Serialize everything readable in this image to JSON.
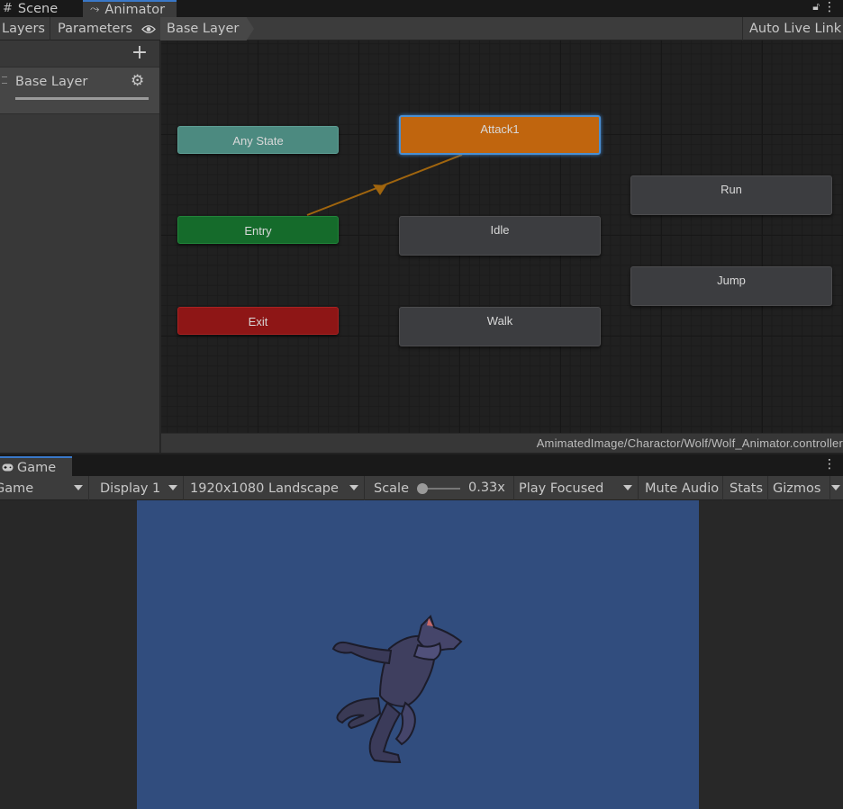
{
  "editor_tabs": {
    "scene": "Scene",
    "animator": "Animator"
  },
  "animator_toolbar": {
    "layers": "Layers",
    "parameters": "Parameters",
    "breadcrumb": "Base Layer",
    "auto_live_link": "Auto Live Link"
  },
  "layers_panel": {
    "add": "+",
    "layer_name": "Base Layer"
  },
  "graph": {
    "nodes": {
      "any_state": "Any State",
      "entry": "Entry",
      "exit": "Exit",
      "attack1": "Attack1",
      "idle": "Idle",
      "walk": "Walk",
      "run": "Run",
      "jump": "Jump"
    },
    "colors": {
      "any_state": "#4c8a80",
      "entry": "#156b2b",
      "exit": "#8e1616",
      "default_state": "#c0650e",
      "state": "#3c3d40",
      "transition": "#a0650e",
      "selection": "#4a8fd2"
    },
    "status_path": "AmimatedImage/Charactor/Wolf/Wolf_Animator.controller"
  },
  "game_tabs": {
    "game": "Game"
  },
  "game_toolbar": {
    "view_mode": "Game",
    "display": "Display 1",
    "resolution": "1920x1080 Landscape",
    "scale_label": "Scale",
    "scale_value": "0.33x",
    "play_mode": "Play Focused",
    "mute_audio": "Mute Audio",
    "stats": "Stats",
    "gizmos": "Gizmos"
  },
  "game_view": {
    "background": "#314d7e"
  }
}
